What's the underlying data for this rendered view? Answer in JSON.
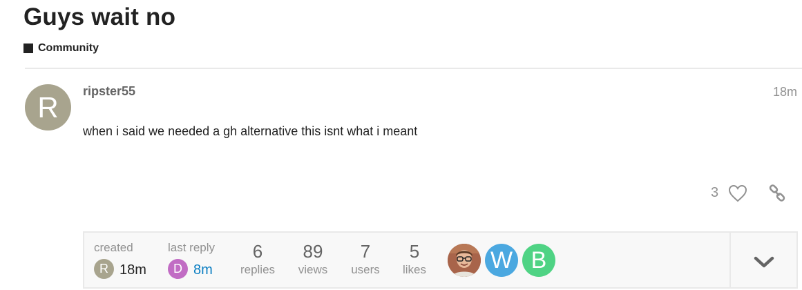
{
  "topic": {
    "title": "Guys wait no",
    "category": "Community"
  },
  "post": {
    "avatar_letter": "R",
    "username": "ripster55",
    "age": "18m",
    "body": "when i said we needed a gh alternative this isnt what i meant",
    "like_count": "3",
    "colors": {
      "avatar": "#a8a48e"
    }
  },
  "topic_map": {
    "created": {
      "label": "created",
      "avatar_letter": "R",
      "time": "18m"
    },
    "last_reply": {
      "label": "last reply",
      "avatar_letter": "D",
      "time": "8m"
    },
    "stats": [
      {
        "value": "6",
        "label": "replies"
      },
      {
        "value": "89",
        "label": "views"
      },
      {
        "value": "7",
        "label": "users"
      },
      {
        "value": "5",
        "label": "likes"
      }
    ],
    "participants": [
      {
        "letter": "",
        "kind": "photo"
      },
      {
        "letter": "W",
        "color": "#4ba8e0"
      },
      {
        "letter": "B",
        "color": "#4fd384"
      }
    ],
    "icons": {
      "expand": "chevron-down-icon",
      "like": "heart-icon",
      "share": "link-icon"
    },
    "colors": {
      "created_avatar": "#a8a48e",
      "last_reply_avatar": "#c16cc4",
      "link": "#0a7ec2"
    }
  }
}
